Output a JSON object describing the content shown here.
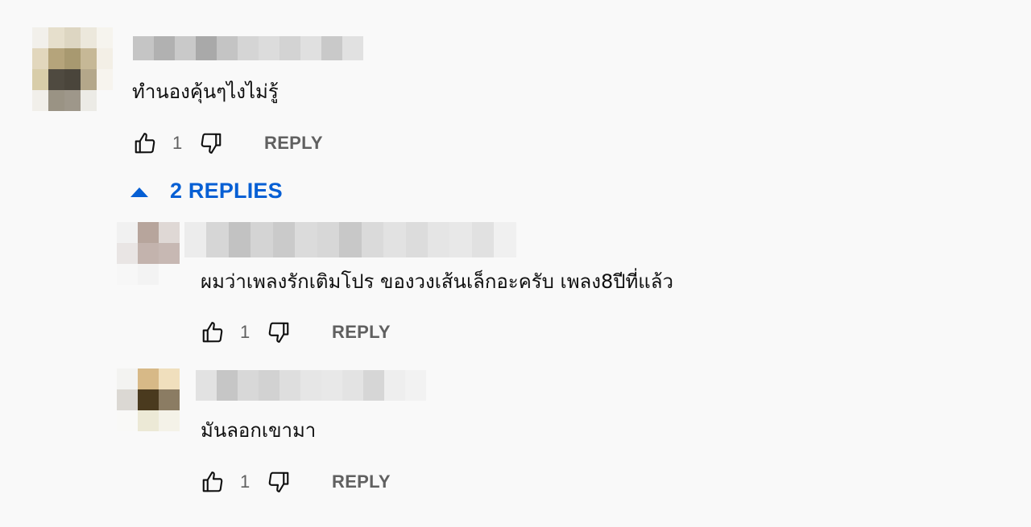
{
  "comments": [
    {
      "text": "ทำนองคุ้นๆไงไม่รู้",
      "likes": "1",
      "reply_label": "REPLY",
      "avatar_pixels": [
        [
          "#f2f0eb",
          "#e6dfcc",
          "#ddd6c2",
          "#ece8dc",
          "#f6f4ee"
        ],
        [
          "#e2d7bd",
          "#b5a47b",
          "#a89970",
          "#c6b896",
          "#f3efe6"
        ],
        [
          "#d8cda9",
          "#4f4a40",
          "#4a453b",
          "#b4a78a",
          "#f7f4ee"
        ],
        [
          "#f1efea",
          "#9a9384",
          "#9e978a",
          "#ecebe6",
          "#f9f9f9"
        ]
      ],
      "author_blocks": [
        "#c5c5c5",
        "#b1b1b1",
        "#c9c9c9",
        "#a9a9a9",
        "#c4c4c4",
        "#d5d5d5",
        "#dcdcdc",
        "#d3d3d3",
        "#e0e0e0",
        "#c9c9c9",
        "#e1e1e1"
      ]
    }
  ],
  "replies_toggle": {
    "label": "2 REPLIES"
  },
  "replies": [
    {
      "text": "ผมว่าเพลงรักเติมโปร ของวงเส้นเล็กอะครับ เพลง8ปีที่แล้ว",
      "likes": "1",
      "reply_label": "REPLY",
      "avatar_pixels": [
        [
          "#f1f1f1",
          "#b7a59c",
          "#dfd8d5"
        ],
        [
          "#e9e5e4",
          "#c3b3ad",
          "#c7b8b3"
        ],
        [
          "#f7f7f7",
          "#f3f3f3",
          "#f9f9f9"
        ]
      ],
      "author_blocks": [
        "#ececec",
        "#d6d6d6",
        "#c2c2c2",
        "#d4d4d4",
        "#cacaca",
        "#dbdbdb",
        "#d7d7d7",
        "#c8c8c8",
        "#dadada",
        "#e2e2e2",
        "#dcdcdc",
        "#e5e5e5",
        "#e8e8e8",
        "#e1e1e1",
        "#f0f0f0"
      ]
    },
    {
      "text": "มันลอกเขามา",
      "likes": "1",
      "reply_label": "REPLY",
      "avatar_pixels": [
        [
          "#f3f3f1",
          "#d7b987",
          "#f0dfbd"
        ],
        [
          "#dbd8d3",
          "#4a3a1e",
          "#8b7c63"
        ],
        [
          "#f9f9f7",
          "#ece9d6",
          "#f4f2e8"
        ]
      ],
      "author_blocks": [
        "#e2e2e2",
        "#c6c6c6",
        "#d8d8d8",
        "#d2d2d2",
        "#dedede",
        "#e6e6e6",
        "#e8e8e8",
        "#e3e3e3",
        "#d6d6d6",
        "#eeeeee",
        "#f2f2f2"
      ]
    }
  ]
}
